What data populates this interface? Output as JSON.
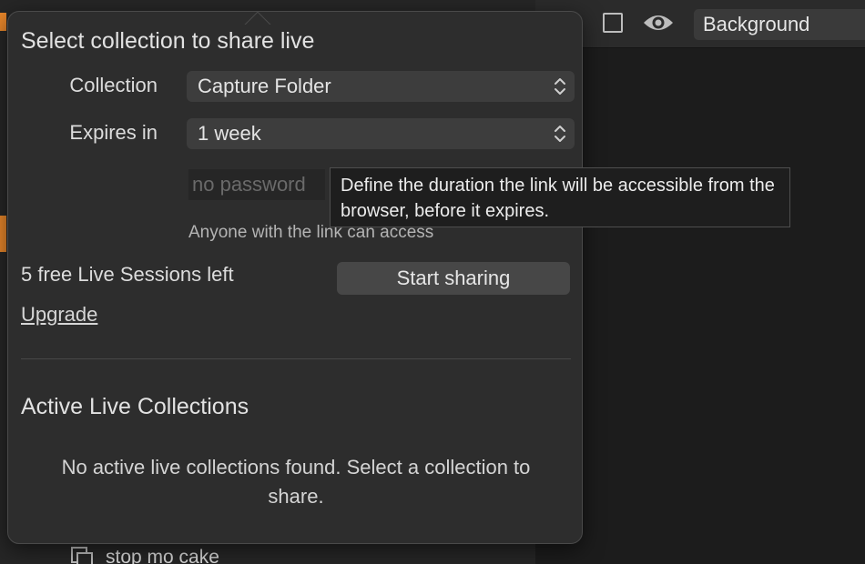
{
  "background": {
    "layer_select_value": "Background",
    "list_item_label": "stop mo cake",
    "accent_color": "#e8862a",
    "icons": [
      "square-icon",
      "eye-icon",
      "stack-icon"
    ]
  },
  "popover": {
    "title": "Select collection to share live",
    "collection": {
      "label": "Collection",
      "value": "Capture Folder"
    },
    "expires": {
      "label": "Expires in",
      "value": "1 week"
    },
    "password": {
      "placeholder": "no password"
    },
    "access_note": "Anyone with the link can access",
    "sessions_left": "5 free Live Sessions left",
    "start_button": "Start sharing",
    "upgrade_link": "Upgrade",
    "active_section_title": "Active Live Collections",
    "empty_message": "No active live collections found. Select a collection to share."
  },
  "tooltip": {
    "text": "Define the duration the link will be accessible from the browser, before it expires."
  }
}
